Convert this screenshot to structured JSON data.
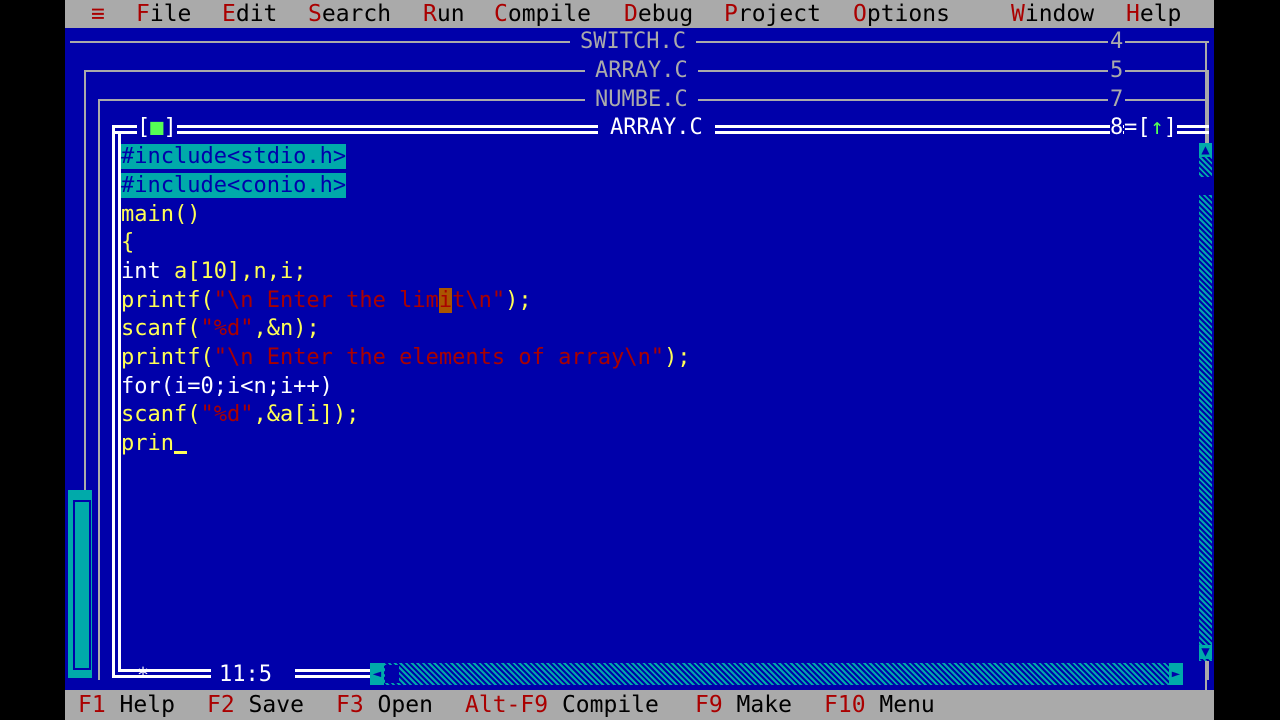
{
  "menu": {
    "system": "≡",
    "items": [
      {
        "hot": "F",
        "rest": "ile"
      },
      {
        "hot": "E",
        "rest": "dit"
      },
      {
        "hot": "S",
        "rest": "earch"
      },
      {
        "hot": "R",
        "rest": "un"
      },
      {
        "hot": "C",
        "rest": "ompile"
      },
      {
        "hot": "D",
        "rest": "ebug"
      },
      {
        "hot": "P",
        "rest": "roject"
      },
      {
        "hot": "O",
        "rest": "ptions"
      },
      {
        "hot": "W",
        "rest": "indow"
      },
      {
        "hot": "H",
        "rest": "elp"
      }
    ]
  },
  "windows": [
    {
      "title": "SWITCH.C",
      "number": "4"
    },
    {
      "title": "ARRAY.C",
      "number": "5"
    },
    {
      "title": "NUMBE.C",
      "number": "7"
    }
  ],
  "active_window": {
    "title": "ARRAY.C",
    "number": "8",
    "close_left": "[",
    "close_mark": "■",
    "close_right": "]",
    "zoom_left": "=[",
    "zoom_mark": "↑",
    "zoom_right": "]",
    "cursor_position": "11:5",
    "marker": "*"
  },
  "code": {
    "line1": "#include<stdio.h>",
    "line2": "#include<conio.h>",
    "line3": "main()",
    "line4": "{",
    "line5_kw": "int",
    "line5_rest": " a[10],n,i;",
    "line6_a": "printf(",
    "line6_str1": "\"\\n Enter the lim",
    "line6_cur": "i",
    "line6_str2": "t\\n\"",
    "line6_b": ");",
    "line7_a": "scanf(",
    "line7_str": "\"%d\"",
    "line7_b": ",&n);",
    "line8_a": "printf(",
    "line8_str": "\"\\n Enter the elements of array\\n\"",
    "line8_b": ");",
    "line9": "for(i=0;i<n;i++)",
    "line10_a": "scanf(",
    "line10_str": "\"%d\"",
    "line10_b": ",&a[i]);",
    "line11": "prin"
  },
  "status": [
    {
      "key": "F1",
      "label": " Help"
    },
    {
      "key": "F2",
      "label": " Save"
    },
    {
      "key": "F3",
      "label": " Open"
    },
    {
      "key": "Alt-F9",
      "label": " Compile"
    },
    {
      "key": "F9",
      "label": " Make"
    },
    {
      "key": "F10",
      "label": " Menu"
    }
  ],
  "colors": {
    "background": "#0000aa",
    "menu_bar": "#aaaaaa",
    "hotkey": "#aa0000",
    "selection": "#00aaaa",
    "code_text": "#ffff55"
  }
}
